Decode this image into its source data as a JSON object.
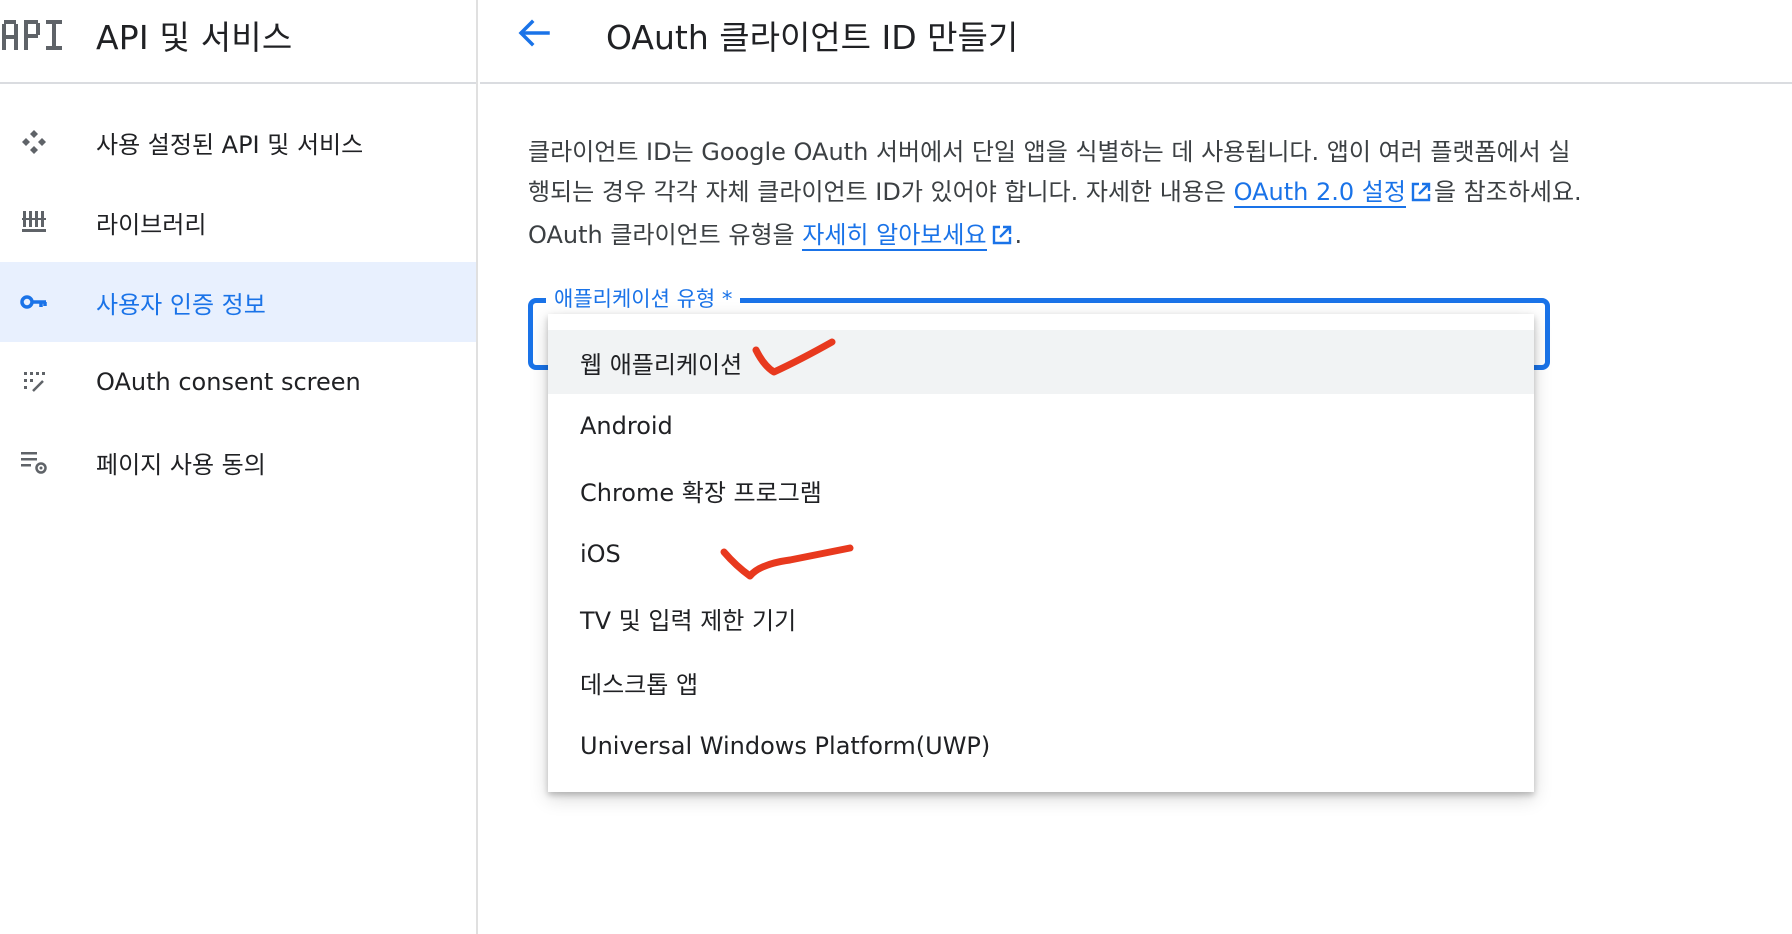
{
  "sidebar": {
    "logo_text": "API",
    "title": "API 및 서비스",
    "items": [
      {
        "label": "사용 설정된 API 및 서비스",
        "icon": "api-diamond-icon",
        "active": false
      },
      {
        "label": "라이브러리",
        "icon": "library-icon",
        "active": false
      },
      {
        "label": "사용자 인증 정보",
        "icon": "key-icon",
        "active": true
      },
      {
        "label": "OAuth consent screen",
        "icon": "consent-grid-icon",
        "active": false
      },
      {
        "label": "페이지 사용 동의",
        "icon": "list-settings-icon",
        "active": false
      }
    ]
  },
  "main": {
    "title": "OAuth 클라이언트 ID 만들기",
    "description": {
      "part1": "클라이언트 ID는 Google OAuth 서버에서 단일 앱을 식별하는 데 사용됩니다. 앱이 여러 플랫폼에서 실행되는 경우 각각 자체 클라이언트 ID가 있어야 합니다. 자세한 내용은 ",
      "link1": "OAuth 2.0 설정",
      "part2": "을 참조하세요. OAuth 클라이언트 유형을 ",
      "link2": "자세히 알아보세요",
      "part3": "."
    },
    "select": {
      "label": "애플리케이션 유형 *",
      "options": [
        "웹 애플리케이션",
        "Android",
        "Chrome 확장 프로그램",
        "iOS",
        "TV 및 입력 제한 기기",
        "데스크톱 앱",
        "Universal Windows Platform(UWP)"
      ],
      "hovered_index": 0
    }
  },
  "colors": {
    "accent": "#1a73e8",
    "active_bg": "#e8f0fe",
    "annotation": "#e8391e"
  }
}
